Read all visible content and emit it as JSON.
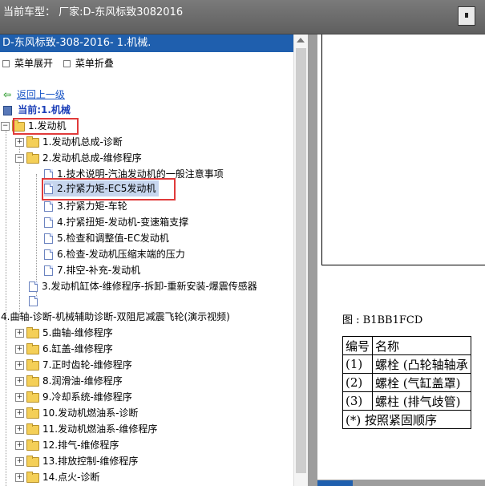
{
  "topbar": {
    "title": "当前车型：  厂家:D-东风标致3082016"
  },
  "tree": {
    "header": "D-东风标致-308-2016- 1.机械.",
    "expand_all": "菜单展开",
    "collapse_all": "菜单折叠",
    "back": "返回上一级",
    "current": "当前:1.机械",
    "items": [
      {
        "label": "1.发动机",
        "type": "folder-open",
        "exp": "−"
      },
      {
        "label": "1.发动机总成-诊断",
        "type": "folder",
        "exp": "+"
      },
      {
        "label": "2.发动机总成-维修程序",
        "type": "folder-open",
        "exp": "−"
      },
      {
        "label": "1.技术说明-汽油发动机的一般注意事项",
        "type": "doc"
      },
      {
        "label": "2.拧紧力矩-EC5发动机",
        "type": "doc"
      },
      {
        "label": "3.拧紧力矩-车轮",
        "type": "doc"
      },
      {
        "label": "4.拧紧扭矩-发动机-变速箱支撑",
        "type": "doc"
      },
      {
        "label": "5.检查和调整值-EC发动机",
        "type": "doc"
      },
      {
        "label": "6.检查-发动机压缩末端的压力",
        "type": "doc"
      },
      {
        "label": "7.排空-补充-发动机",
        "type": "doc"
      },
      {
        "label": "3.发动机缸体-维修程序-拆卸-重新安装-爆震传感器",
        "type": "doc"
      },
      {
        "label": "",
        "type": "doc"
      },
      {
        "label": "4.曲轴-诊断-机械辅助诊断-双阻尼减震飞轮(演示视频)",
        "type": "text"
      },
      {
        "label": "5.曲轴-维修程序",
        "type": "folder",
        "exp": "+"
      },
      {
        "label": "6.缸盖-维修程序",
        "type": "folder",
        "exp": "+"
      },
      {
        "label": "7.正时齿轮-维修程序",
        "type": "folder",
        "exp": "+"
      },
      {
        "label": "8.润滑油-维修程序",
        "type": "folder",
        "exp": "+"
      },
      {
        "label": "9.冷却系统-维修程序",
        "type": "folder",
        "exp": "+"
      },
      {
        "label": "10.发动机燃油系-诊断",
        "type": "folder",
        "exp": "+"
      },
      {
        "label": "11.发动机燃油系-维修程序",
        "type": "folder",
        "exp": "+"
      },
      {
        "label": "12.排气-维修程序",
        "type": "folder",
        "exp": "+"
      },
      {
        "label": "13.排放控制-维修程序",
        "type": "folder",
        "exp": "+"
      },
      {
        "label": "14.点火-诊断",
        "type": "folder",
        "exp": "+"
      }
    ]
  },
  "document": {
    "caption": "图 : B1BB1FCD",
    "legend_header": [
      "编号",
      "名称"
    ],
    "legend_rows": [
      [
        "(1)",
        "螺栓 (凸轮轴轴承"
      ],
      [
        "(2)",
        "螺栓 (气缸盖罩)"
      ],
      [
        "(3)",
        "螺柱 (排气歧管)"
      ]
    ],
    "note": "(*) 按照紧固顺序"
  }
}
